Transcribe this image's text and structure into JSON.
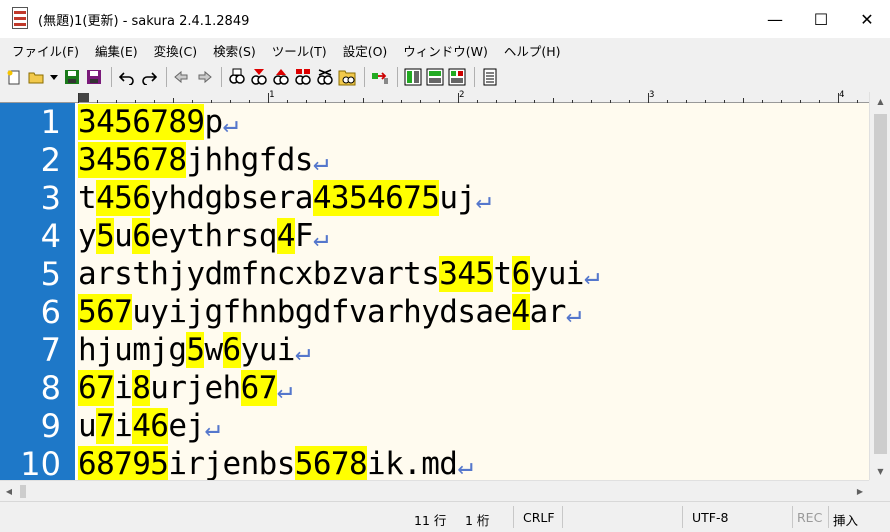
{
  "window": {
    "title": "(無題)1(更新) - sakura 2.4.1.2849",
    "minimize": "—",
    "maximize": "☐",
    "close": "✕"
  },
  "menu": [
    "ファイル(F)",
    "編集(E)",
    "変換(C)",
    "検索(S)",
    "ツール(T)",
    "設定(O)",
    "ウィンドウ(W)",
    "ヘルプ(H)"
  ],
  "ruler": {
    "marks": [
      "1",
      "2",
      "3",
      "4"
    ]
  },
  "editor": {
    "line_numbers": [
      "1",
      "2",
      "3",
      "4",
      "5",
      "6",
      "7",
      "8",
      "9",
      "10"
    ],
    "eol_symbol": "↵",
    "lines": [
      [
        {
          "t": "3456789",
          "h": true
        },
        {
          "t": "p",
          "h": false
        }
      ],
      [
        {
          "t": "345678",
          "h": true
        },
        {
          "t": "jhhgfds",
          "h": false
        }
      ],
      [
        {
          "t": "t",
          "h": false
        },
        {
          "t": "456",
          "h": true
        },
        {
          "t": "yhdgbsera",
          "h": false
        },
        {
          "t": "4354675",
          "h": true
        },
        {
          "t": "uj",
          "h": false
        }
      ],
      [
        {
          "t": "y",
          "h": false
        },
        {
          "t": "5",
          "h": true
        },
        {
          "t": "u",
          "h": false
        },
        {
          "t": "6",
          "h": true
        },
        {
          "t": "eythrsq",
          "h": false
        },
        {
          "t": "4",
          "h": true
        },
        {
          "t": "F",
          "h": false
        }
      ],
      [
        {
          "t": "arsthjydmfncxbzvarts",
          "h": false
        },
        {
          "t": "345",
          "h": true
        },
        {
          "t": "t",
          "h": false
        },
        {
          "t": "6",
          "h": true
        },
        {
          "t": "yui",
          "h": false
        }
      ],
      [
        {
          "t": "567",
          "h": true
        },
        {
          "t": "uyijgfhnbgdfvarhydsae",
          "h": false
        },
        {
          "t": "4",
          "h": true
        },
        {
          "t": "ar",
          "h": false
        }
      ],
      [
        {
          "t": "hjumjg",
          "h": false
        },
        {
          "t": "5",
          "h": true
        },
        {
          "t": "w",
          "h": false
        },
        {
          "t": "6",
          "h": true
        },
        {
          "t": "yui",
          "h": false
        }
      ],
      [
        {
          "t": "67",
          "h": true
        },
        {
          "t": "i",
          "h": false
        },
        {
          "t": "8",
          "h": true
        },
        {
          "t": "urjeh",
          "h": false
        },
        {
          "t": "67",
          "h": true
        }
      ],
      [
        {
          "t": "u",
          "h": false
        },
        {
          "t": "7",
          "h": true
        },
        {
          "t": "i",
          "h": false
        },
        {
          "t": "46",
          "h": true
        },
        {
          "t": "ej",
          "h": false
        }
      ],
      [
        {
          "t": "68795",
          "h": true
        },
        {
          "t": "irjenbs",
          "h": false
        },
        {
          "t": "5678",
          "h": true
        },
        {
          "t": "ik.md",
          "h": false
        }
      ]
    ]
  },
  "status": {
    "row": "11 行",
    "col": "1 桁",
    "eol": "CRLF",
    "encoding": "UTF-8",
    "rec": "REC",
    "mode": "挿入"
  },
  "colors": {
    "gutter": "#1e78c8",
    "highlight": "#ffff00",
    "editor_bg": "#fffbef",
    "eol": "#5577cc"
  }
}
